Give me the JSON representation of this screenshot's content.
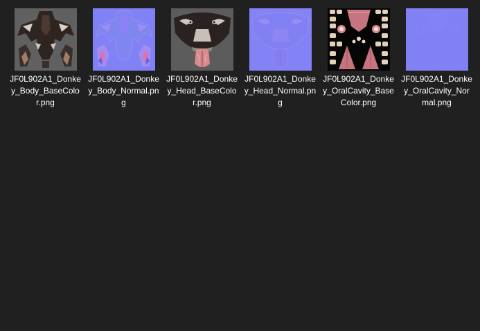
{
  "explorer": {
    "view": "large-icons",
    "background_color": "#202020",
    "text_color": "#ffffff",
    "files": [
      {
        "name": "JF0L902A1_Donkey_Body_BaseColor.png",
        "thumbnail": "donkey-body-basecolor-texture"
      },
      {
        "name": "JF0L902A1_Donkey_Body_Normal.png",
        "thumbnail": "donkey-body-normal-map"
      },
      {
        "name": "JF0L902A1_Donkey_Head_BaseColor.png",
        "thumbnail": "donkey-head-basecolor-texture"
      },
      {
        "name": "JF0L902A1_Donkey_Head_Normal.png",
        "thumbnail": "donkey-head-normal-map"
      },
      {
        "name": "JF0L902A1_Donkey_OralCavity_BaseColor.png",
        "thumbnail": "donkey-oralcavity-basecolor-texture"
      },
      {
        "name": "JF0L902A1_Donkey_OralCavity_Normal.png",
        "thumbnail": "donkey-oralcavity-normal-map"
      }
    ]
  }
}
